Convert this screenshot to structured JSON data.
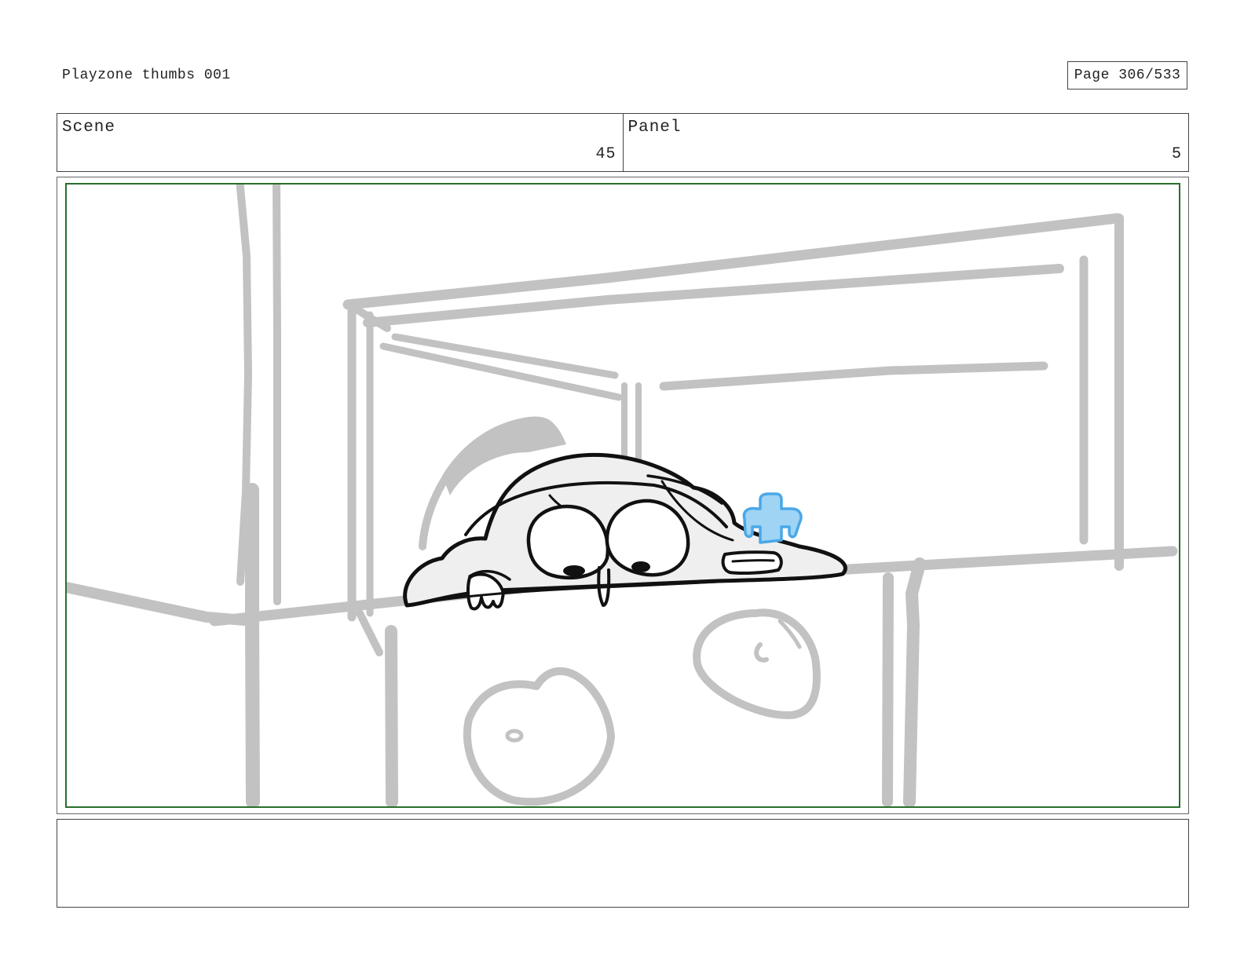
{
  "header": {
    "project_title": "Playzone thumbs 001",
    "page_counter": "Page 306/533"
  },
  "info": {
    "scene_label": "Scene",
    "scene_number": "45",
    "panel_label": "Panel",
    "panel_number": "5"
  },
  "colors": {
    "sketch_gray": "#c2c2c2",
    "ink_black": "#111111",
    "toy_blue": "#9fd4f5",
    "safe_area_green": "#2a6e2a"
  }
}
